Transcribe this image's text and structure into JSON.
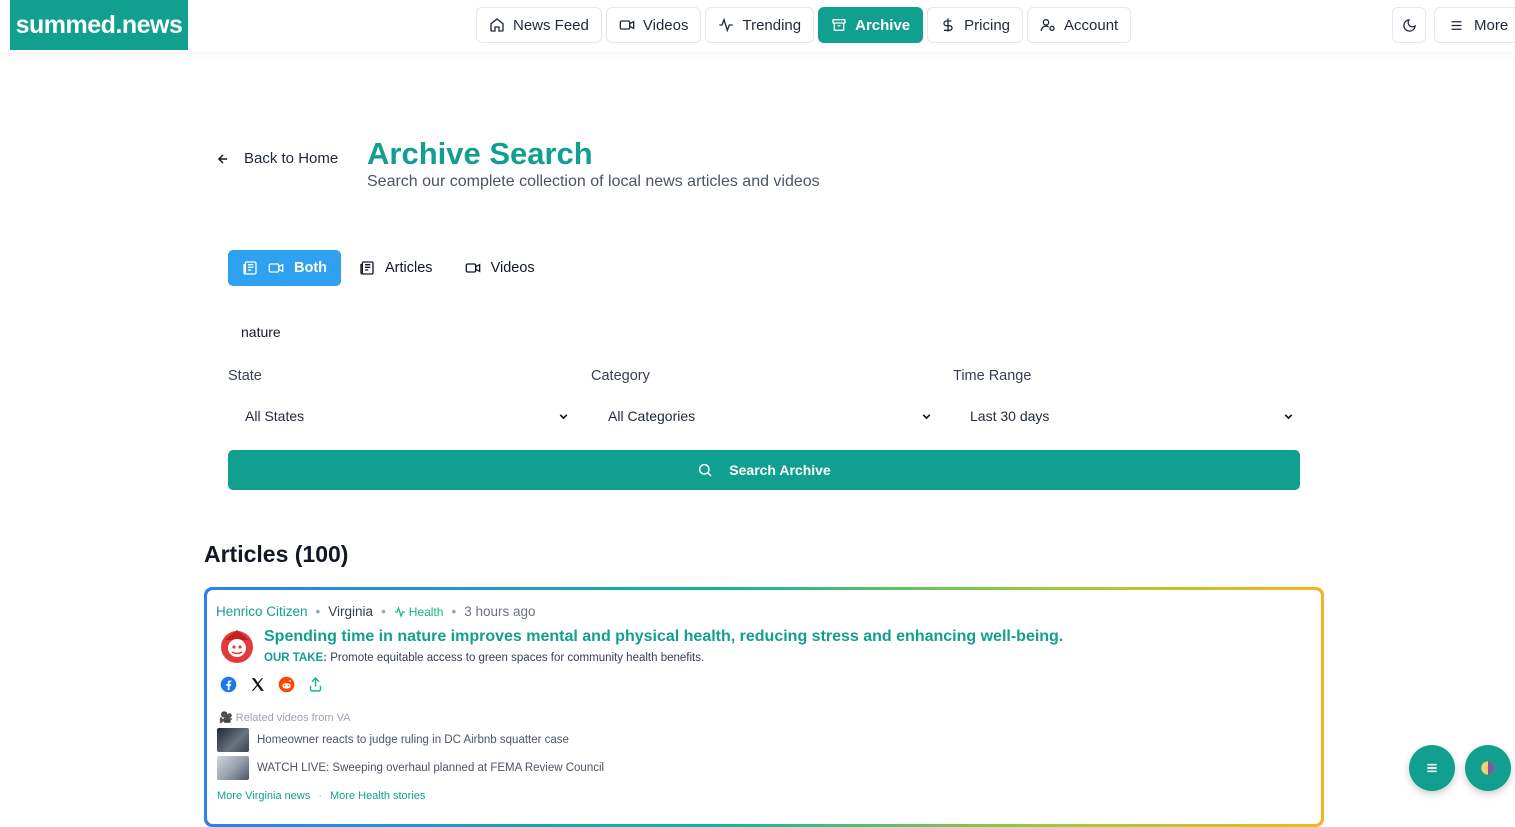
{
  "header": {
    "logo": "summed.news",
    "nav": [
      "News Feed",
      "Videos",
      "Trending",
      "Archive",
      "Pricing",
      "Account"
    ],
    "more_label": "More"
  },
  "page": {
    "back_label": "Back to Home",
    "title": "Archive Search",
    "subtitle": "Search our complete collection of local news articles and videos"
  },
  "tabs": [
    "Both",
    "Articles",
    "Videos"
  ],
  "search": {
    "value": "nature",
    "button_label": "Search Archive"
  },
  "filters": {
    "state_label": "State",
    "state_value": "All States",
    "category_label": "Category",
    "category_value": "All Categories",
    "time_label": "Time Range",
    "time_value": "Last 30 days"
  },
  "results": {
    "heading": "Articles (100)",
    "article": {
      "source": "Henrico Citizen",
      "state": "Virginia",
      "category": "Health",
      "time": "3 hours ago",
      "headline": "Spending time in nature improves mental and physical health, reducing stress and enhancing well-being.",
      "take_label": "OUR TAKE:",
      "take_text": "Promote equitable access to green spaces for community health benefits.",
      "related_title": "Related videos from VA",
      "related": [
        "Homeowner reacts to judge ruling in DC Airbnb squatter case",
        "WATCH LIVE: Sweeping overhaul planned at FEMA Review Council"
      ],
      "more_state": "More Virginia news",
      "more_category": "More Health stories"
    }
  },
  "colors": {
    "brand": "#119f8f",
    "tab_active": "#2ea1f0"
  }
}
